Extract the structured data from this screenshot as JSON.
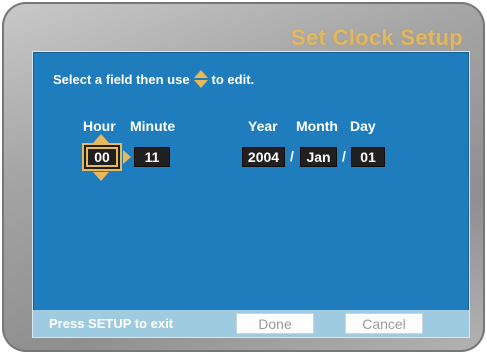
{
  "title": "Set Clock Setup",
  "instructions": {
    "prefix": "Select a field then use",
    "icon": "up-down-arrow-icon",
    "suffix": "to edit."
  },
  "labels": {
    "hour": "Hour",
    "minute": "Minute",
    "year": "Year",
    "month": "Month",
    "day": "Day"
  },
  "fields": {
    "hour": "00",
    "minute": "11",
    "year": "2004",
    "month": "Jan",
    "day": "01"
  },
  "separators": {
    "date": "/"
  },
  "footer": {
    "exit_hint": "Press SETUP to exit",
    "done_label": "Done",
    "cancel_label": "Cancel"
  },
  "colors": {
    "accent": "#e8b95a",
    "panel": "#1f7dbd",
    "footer": "#9ecbe0",
    "field": "#202020"
  }
}
